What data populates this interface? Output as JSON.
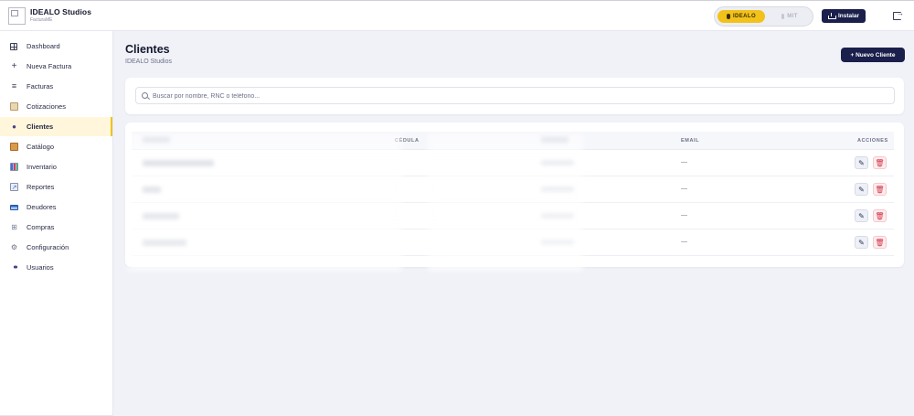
{
  "brand": {
    "name": "IDEALO Studios",
    "sub": "FacturaME"
  },
  "toggle": {
    "active": "IDEALO",
    "inactive": "MIT"
  },
  "install_label": "Instalar",
  "sidebar": {
    "items": [
      {
        "label": "Dashboard",
        "icon": "grid-icon"
      },
      {
        "label": "Nueva Factura",
        "icon": "plus-icon"
      },
      {
        "label": "Facturas",
        "icon": "list-icon"
      },
      {
        "label": "Cotizaciones",
        "icon": "clipboard-icon"
      },
      {
        "label": "Clientes",
        "icon": "user-icon"
      },
      {
        "label": "Catálogo",
        "icon": "package-icon"
      },
      {
        "label": "Inventario",
        "icon": "bar-chart-icon"
      },
      {
        "label": "Reportes",
        "icon": "trend-chart-icon"
      },
      {
        "label": "Deudores",
        "icon": "card-icon"
      },
      {
        "label": "Compras",
        "icon": "cart-icon"
      },
      {
        "label": "Configuración",
        "icon": "gear-icon"
      },
      {
        "label": "Usuarios",
        "icon": "users-icon"
      }
    ],
    "active": "Clientes"
  },
  "page": {
    "title": "Clientes",
    "subtitle": "IDEALO Studios",
    "new_button": "+ Nuevo Cliente"
  },
  "search": {
    "placeholder": "Buscar por nombre, RNC o teléfono...",
    "value": ""
  },
  "table": {
    "headers": {
      "cedula": "CÉDULA",
      "email": "EMAIL",
      "acciones": "ACCIONES"
    },
    "rows": [
      {
        "email": "—"
      },
      {
        "email": "—"
      },
      {
        "email": "—"
      },
      {
        "email": "—"
      }
    ]
  },
  "colors": {
    "accent": "#f2c21b",
    "primary": "#1b1f4b",
    "danger": "#d23246"
  }
}
